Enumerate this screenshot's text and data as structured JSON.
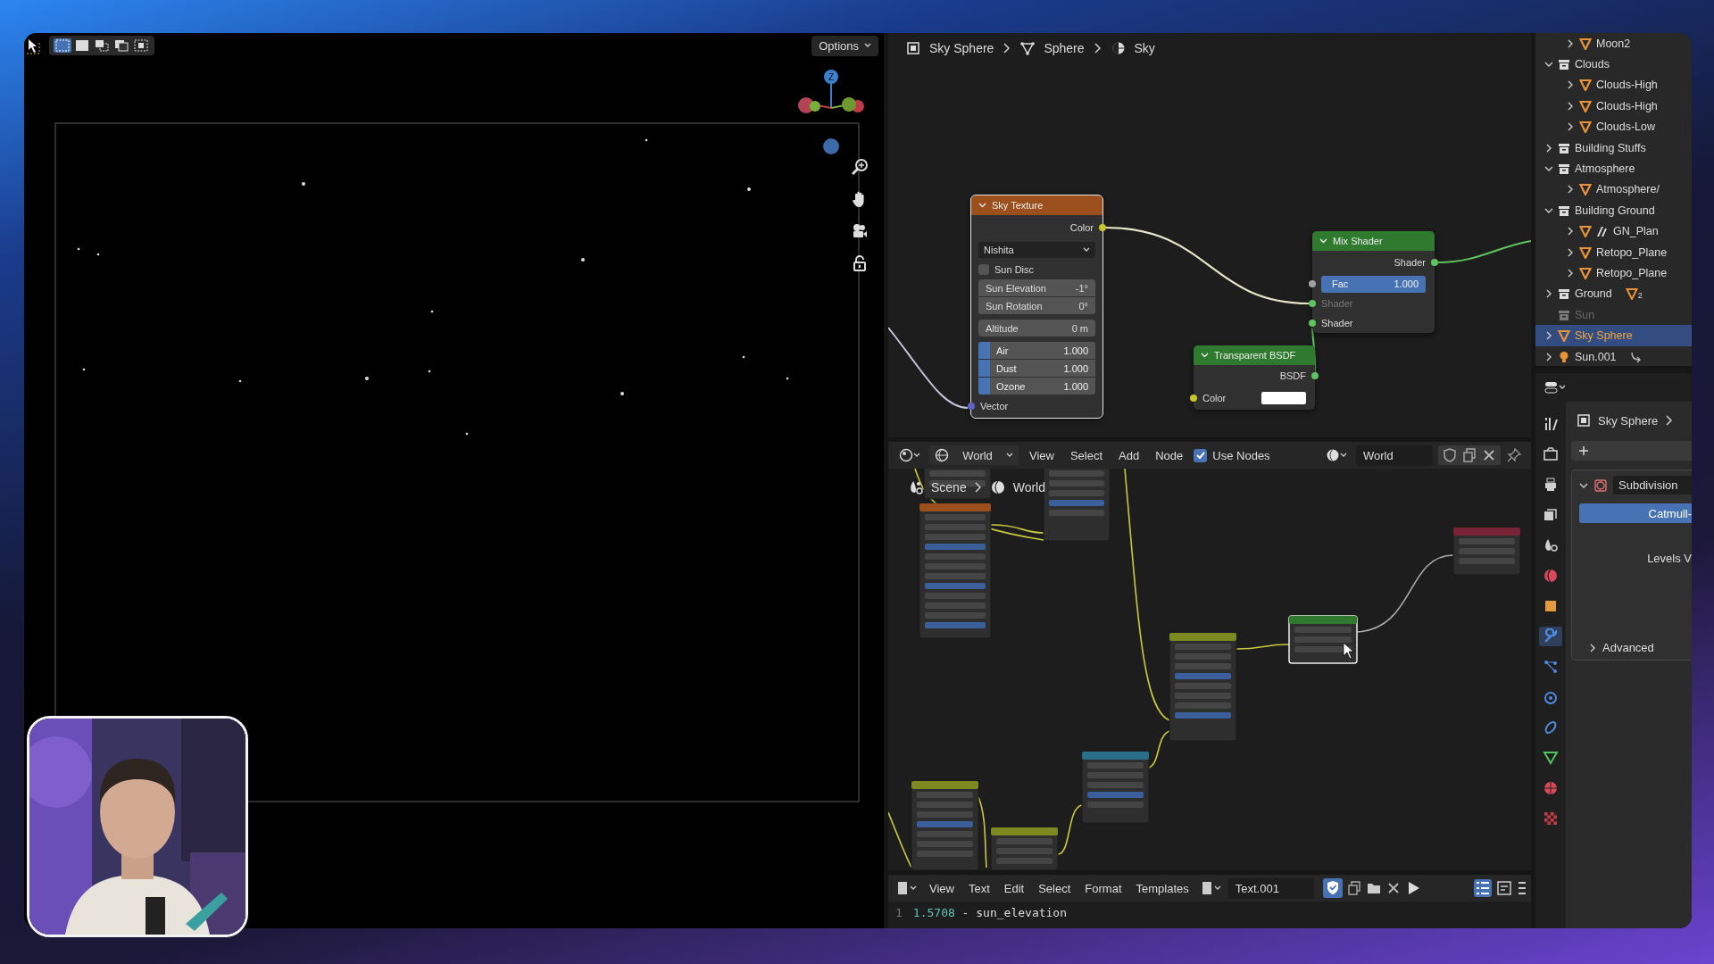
{
  "viewport": {
    "tool_modes": [
      {
        "selected": true
      },
      {
        "selected": false
      },
      {
        "selected": false
      },
      {
        "selected": false
      },
      {
        "selected": false
      }
    ],
    "options": "Options",
    "gizmo_axis": "Z"
  },
  "top_nodes": {
    "breadcrumbs": [
      "Sky Sphere",
      "Sphere",
      "Sky"
    ],
    "sky": {
      "title": "Sky Texture",
      "color": "#9a4f1c",
      "output": "Color",
      "type": "Nishita",
      "sun_disc": {
        "label": "Sun Disc",
        "checked": false
      },
      "angles": [
        {
          "label": "Sun Elevation",
          "value": "-1°"
        },
        {
          "label": "Sun Rotation",
          "value": "0°"
        }
      ],
      "altitude": {
        "label": "Altitude",
        "value": "0 m"
      },
      "factors": [
        {
          "label": "Air",
          "value": "1.000",
          "level": 0.1
        },
        {
          "label": "Dust",
          "value": "1.000",
          "level": 0.1
        },
        {
          "label": "Ozone",
          "value": "1.000",
          "level": 0.1
        }
      ],
      "input": "Vector"
    },
    "mix": {
      "title": "Mix Shader",
      "color": "#2f7a2f",
      "output": "Shader",
      "fac": {
        "label": "Fac",
        "value": "1.000",
        "level": 1
      },
      "inputs": [
        {
          "label": "Shader",
          "disabled": true
        },
        {
          "label": "Shader",
          "disabled": false
        }
      ]
    },
    "transparent": {
      "title": "Transparent BSDF",
      "color": "#2f7a2f",
      "output": "BSDF",
      "input": "Color"
    }
  },
  "bottom_nodes": {
    "world_menu": "World",
    "menus": [
      "View",
      "Select",
      "Add",
      "Node"
    ],
    "use_nodes": {
      "label": "Use Nodes",
      "checked": true
    },
    "world_field": "World",
    "breadcrumbs": [
      "Scene",
      "World"
    ]
  },
  "text_editor": {
    "menus": [
      "View",
      "Text",
      "Edit",
      "Select",
      "Format",
      "Templates"
    ],
    "file": "Text.001",
    "line_number": "1",
    "value": "1.5708",
    "rest": "- sun_elevation"
  },
  "outliner": {
    "items": [
      {
        "children": [
          {
            "label": "Moon2",
            "kind": "mesh",
            "expanded": false,
            "selected": false,
            "disabled": false
          }
        ]
      },
      {
        "label": "Clouds",
        "kind": "collection",
        "expanded": true,
        "selected": false,
        "disabled": false,
        "children": [
          {
            "label": "Clouds-High",
            "kind": "mesh",
            "expanded": false,
            "selected": false,
            "disabled": false
          },
          {
            "label": "Clouds-High",
            "kind": "mesh",
            "expanded": false,
            "selected": false,
            "disabled": false
          },
          {
            "label": "Clouds-Low",
            "kind": "mesh",
            "expanded": false,
            "selected": false,
            "disabled": false
          }
        ]
      },
      {
        "label": "Building Stuffs",
        "kind": "collection",
        "expanded": false,
        "selected": false,
        "disabled": false
      },
      {
        "label": "Atmosphere",
        "kind": "collection",
        "expanded": true,
        "selected": false,
        "disabled": false,
        "children": [
          {
            "label": "Atmosphere/",
            "kind": "mesh",
            "expanded": false,
            "selected": false,
            "disabled": false
          }
        ]
      },
      {
        "label": "Building Ground",
        "kind": "collection",
        "expanded": true,
        "selected": false,
        "disabled": false,
        "children": [
          {
            "label": "GN_Plan",
            "kind": "mesh",
            "geonodes": true,
            "expanded": false,
            "selected": false,
            "disabled": false
          },
          {
            "label": "Retopo_Plane",
            "kind": "mesh",
            "expanded": false,
            "selected": false,
            "disabled": false
          },
          {
            "label": "Retopo_Plane",
            "kind": "mesh",
            "expanded": false,
            "selected": false,
            "disabled": false
          }
        ]
      },
      {
        "label": "Ground",
        "kind": "collection",
        "expanded": false,
        "selected": false,
        "disabled": false,
        "extra": {
          "kind": "mesh_data",
          "count": "2"
        }
      },
      {
        "label": "Sun",
        "kind": "collection",
        "selected": false,
        "disabled": true
      },
      {
        "label": "Sky Sphere",
        "kind": "mesh",
        "expanded": false,
        "selected": true,
        "disabled": false
      },
      {
        "label": "Sun.001",
        "kind": "light",
        "expanded": false,
        "selected": false,
        "disabled": false,
        "extra": {
          "kind": "link"
        }
      }
    ]
  },
  "properties": {
    "tabs": [
      {
        "kind": "tool",
        "selected": false
      },
      {
        "kind": "render",
        "selected": false
      },
      {
        "kind": "output",
        "selected": false
      },
      {
        "kind": "view_layer",
        "selected": false
      },
      {
        "kind": "scene",
        "selected": false
      },
      {
        "kind": "world",
        "selected": false
      },
      {
        "kind": "object",
        "selected": false
      },
      {
        "kind": "modifier",
        "selected": true
      },
      {
        "kind": "particles",
        "selected": false
      },
      {
        "kind": "physics",
        "selected": false
      },
      {
        "kind": "constraints",
        "selected": false
      },
      {
        "kind": "data",
        "selected": false
      },
      {
        "kind": "material",
        "selected": false
      },
      {
        "kind": "texture",
        "selected": false
      }
    ],
    "object": "Sky Sphere",
    "modifier": {
      "name": "Subdivision",
      "type_button": "Catmull-",
      "levels_label": "Levels V",
      "advanced": {
        "label": "Advanced",
        "expanded": false
      }
    }
  }
}
